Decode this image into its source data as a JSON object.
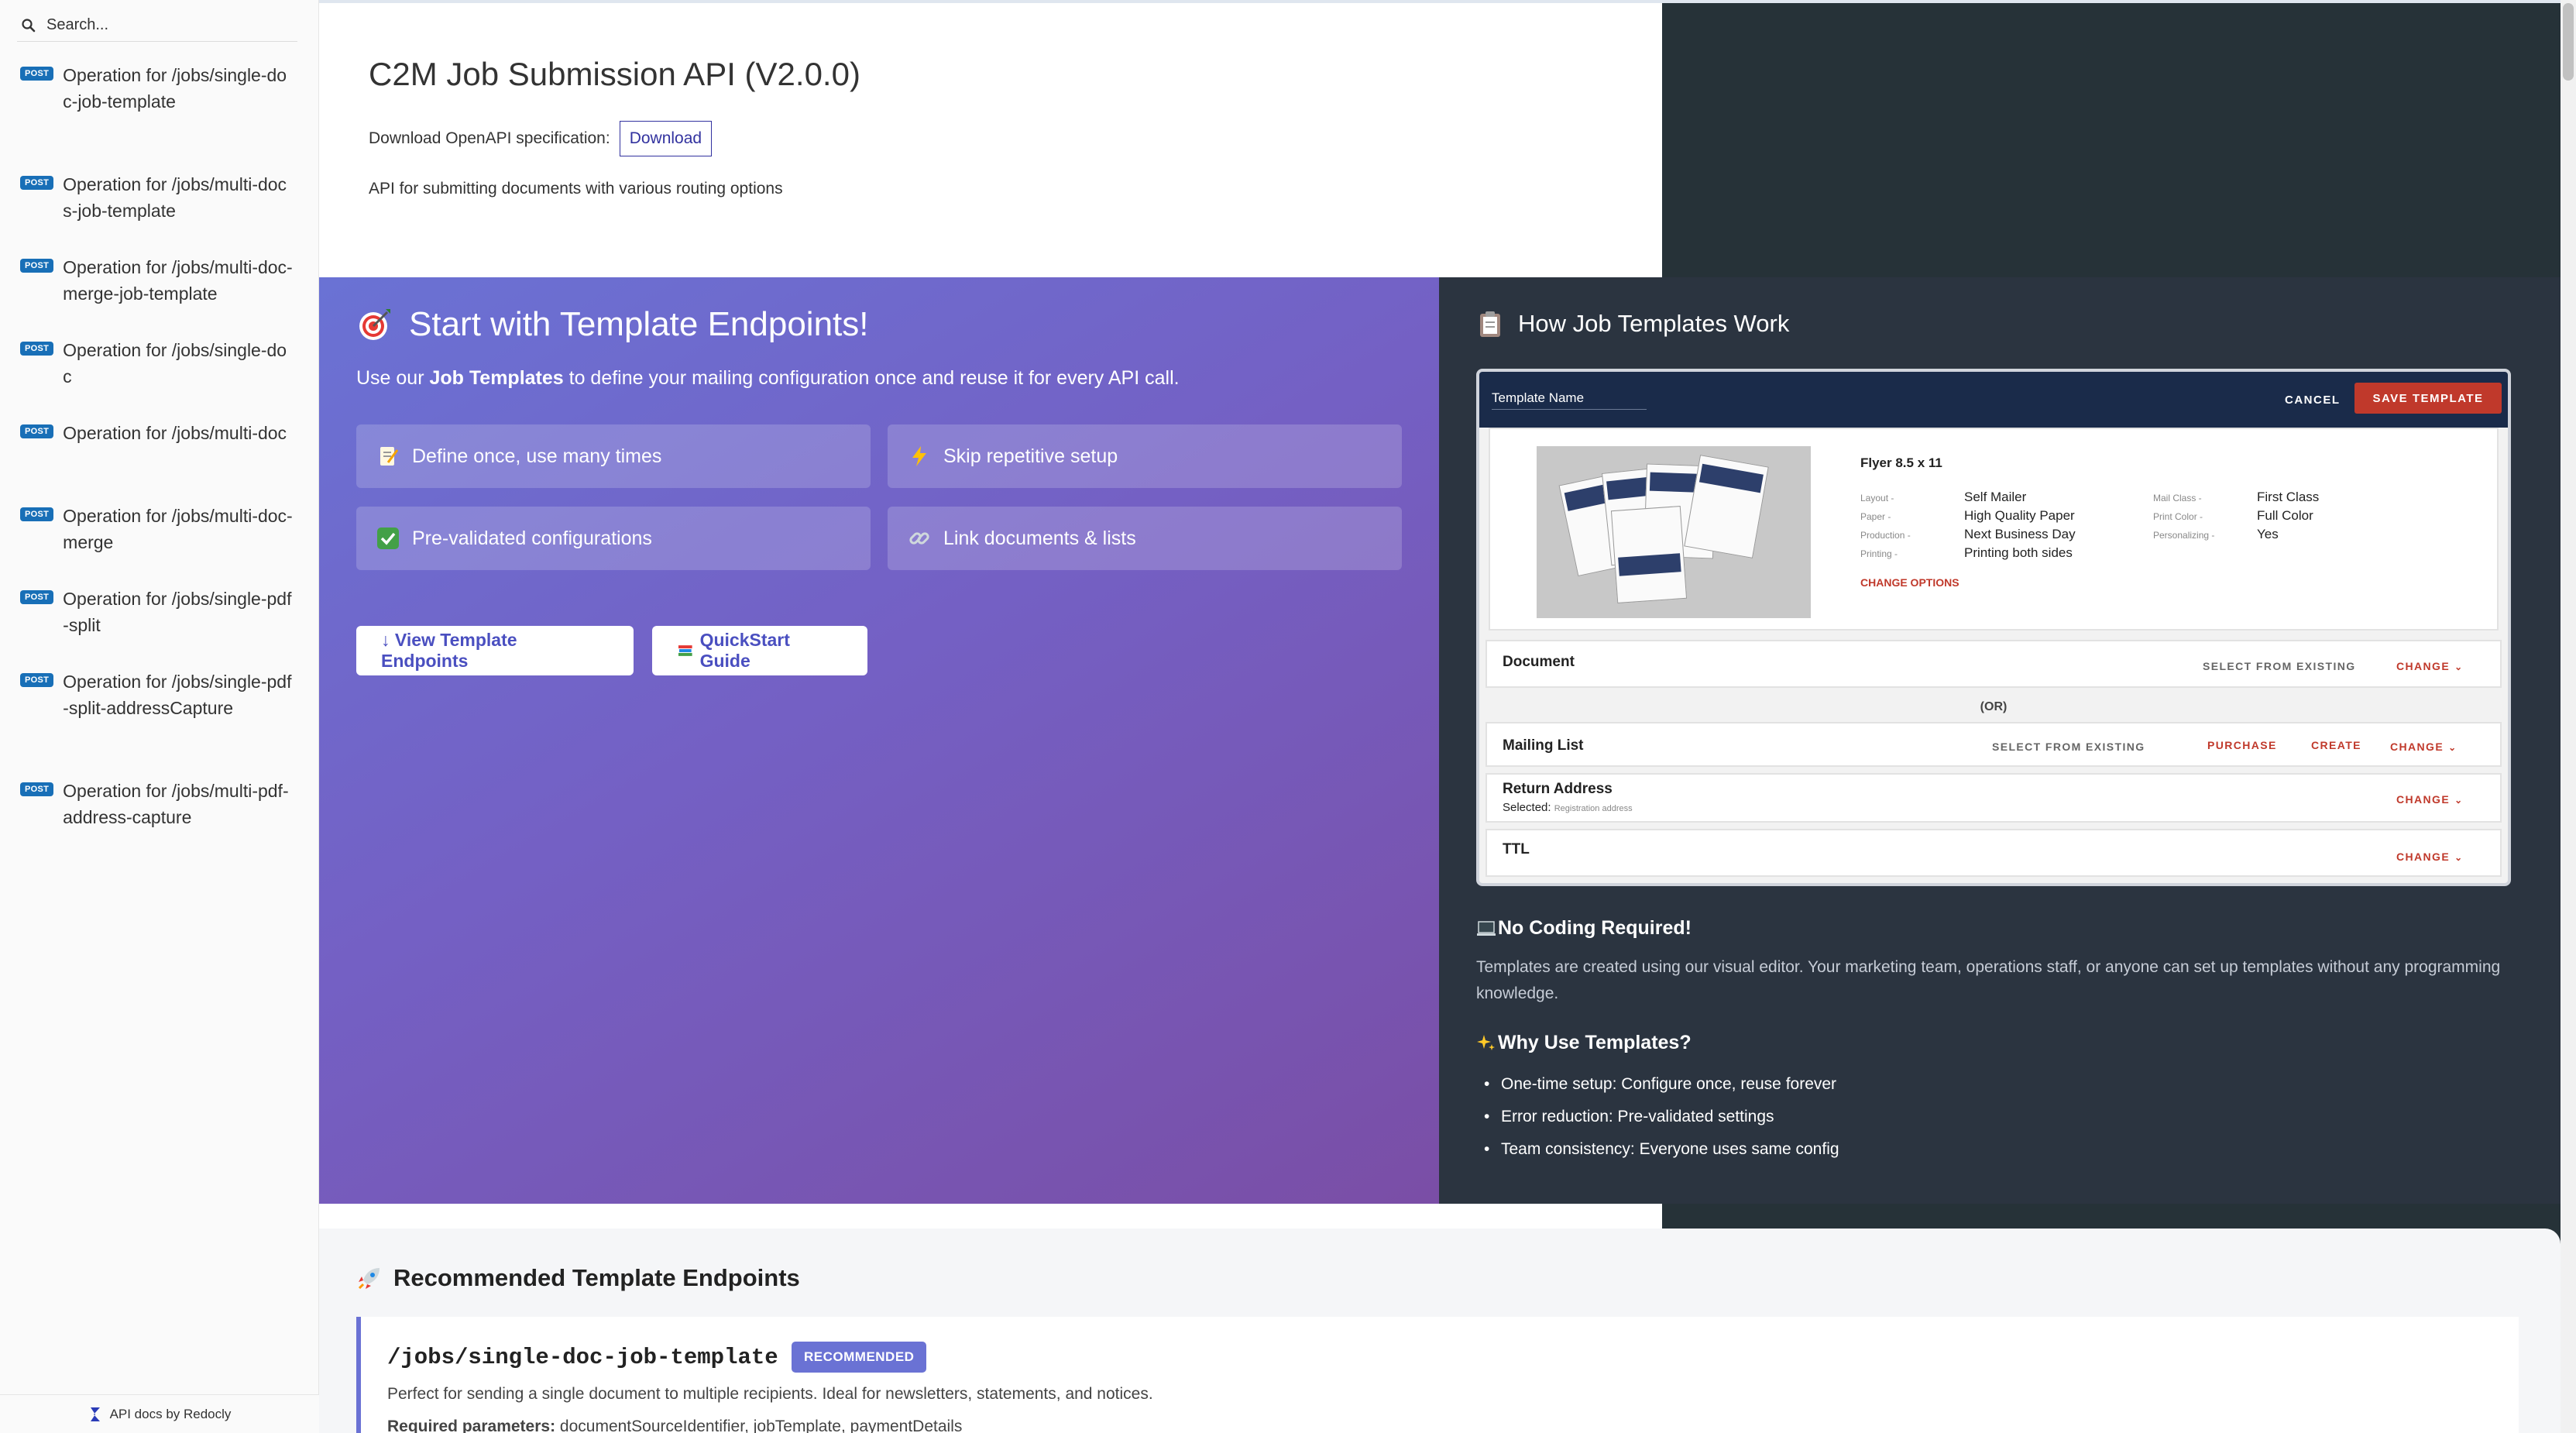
{
  "sidebar": {
    "search_placeholder": "Search...",
    "items": [
      {
        "method": "POST",
        "label": "Operation for /jobs/single-doc-job-template"
      },
      {
        "method": "POST",
        "label": "Operation for /jobs/multi-docs-job-template"
      },
      {
        "method": "POST",
        "label": "Operation for /jobs/multi-doc-merge-job-template"
      },
      {
        "method": "POST",
        "label": "Operation for /jobs/single-doc"
      },
      {
        "method": "POST",
        "label": "Operation for /jobs/multi-doc"
      },
      {
        "method": "POST",
        "label": "Operation for /jobs/multi-doc-merge"
      },
      {
        "method": "POST",
        "label": "Operation for /jobs/single-pdf-split"
      },
      {
        "method": "POST",
        "label": "Operation for /jobs/single-pdf-split-addressCapture"
      },
      {
        "method": "POST",
        "label": "Operation for /jobs/multi-pdf-address-capture"
      }
    ],
    "footer": "API docs by Redocly"
  },
  "header": {
    "title": "C2M Job Submission API (V2.0.0)",
    "download_label": "Download OpenAPI specification:",
    "download_button": "Download",
    "description": "API for submitting documents with various routing options"
  },
  "hero": {
    "title": "Start with Template Endpoints!",
    "subtitle_pre": "Use our ",
    "subtitle_bold": "Job Templates",
    "subtitle_post": " to define your mailing configuration once and reuse it for every API call.",
    "features": [
      {
        "icon": "memo-icon",
        "label": "Define once, use many times"
      },
      {
        "icon": "lightning-icon",
        "label": "Skip repetitive setup"
      },
      {
        "icon": "check-icon",
        "label": "Pre-validated configurations"
      },
      {
        "icon": "link-icon",
        "label": "Link documents & lists"
      }
    ],
    "btn_view": "↓ View Template Endpoints",
    "btn_quickstart": "QuickStart Guide"
  },
  "howto": {
    "title": "How Job Templates Work",
    "mock": {
      "template_name": "Template Name",
      "cancel": "CANCEL",
      "save": "SAVE TEMPLATE",
      "flyer_title": "Flyer 8.5 x 11",
      "specs_left": [
        {
          "k": "Layout -",
          "v": "Self Mailer"
        },
        {
          "k": "Paper -",
          "v": "High Quality Paper"
        },
        {
          "k": "Production -",
          "v": "Next Business Day"
        },
        {
          "k": "Printing -",
          "v": "Printing both sides"
        }
      ],
      "specs_right": [
        {
          "k": "Mail Class -",
          "v": "First Class"
        },
        {
          "k": "Print Color -",
          "v": "Full Color"
        },
        {
          "k": "Personalizing -",
          "v": "Yes"
        }
      ],
      "change_options": "CHANGE OPTIONS",
      "document_label": "Document",
      "select_existing": "SELECT FROM EXISTING",
      "change": "CHANGE",
      "or": "(OR)",
      "mailing_list_label": "Mailing List",
      "purchase": "PURCHASE",
      "create": "CREATE",
      "return_address_label": "Return Address",
      "selected_label": "Selected:",
      "selected_value": "Registration address",
      "ttl_label": "TTL"
    },
    "nocode_title": "No Coding Required!",
    "nocode_text": "Templates are created using our visual editor. Your marketing team, operations staff, or anyone can set up templates without any programming knowledge.",
    "why_title": "Why Use Templates?",
    "why_items": [
      "One-time setup: Configure once, reuse forever",
      "Error reduction: Pre-validated settings",
      "Team consistency: Everyone uses same config"
    ]
  },
  "recommended": {
    "title": "Recommended Template Endpoints",
    "path": "/jobs/single-doc-job-template",
    "badge": "RECOMMENDED",
    "description": "Perfect for sending a single document to multiple recipients. Ideal for newsletters, statements, and notices.",
    "required_label": "Required parameters:",
    "required_value": "documentSourceIdentifier, jobTemplate, paymentDetails"
  },
  "colors": {
    "post_badge": "#186fb7",
    "hero_gradient_start": "#6a72d4",
    "hero_gradient_end": "#7a4ea6",
    "dark_panel": "#2b3440",
    "accent_red": "#c0392b"
  }
}
